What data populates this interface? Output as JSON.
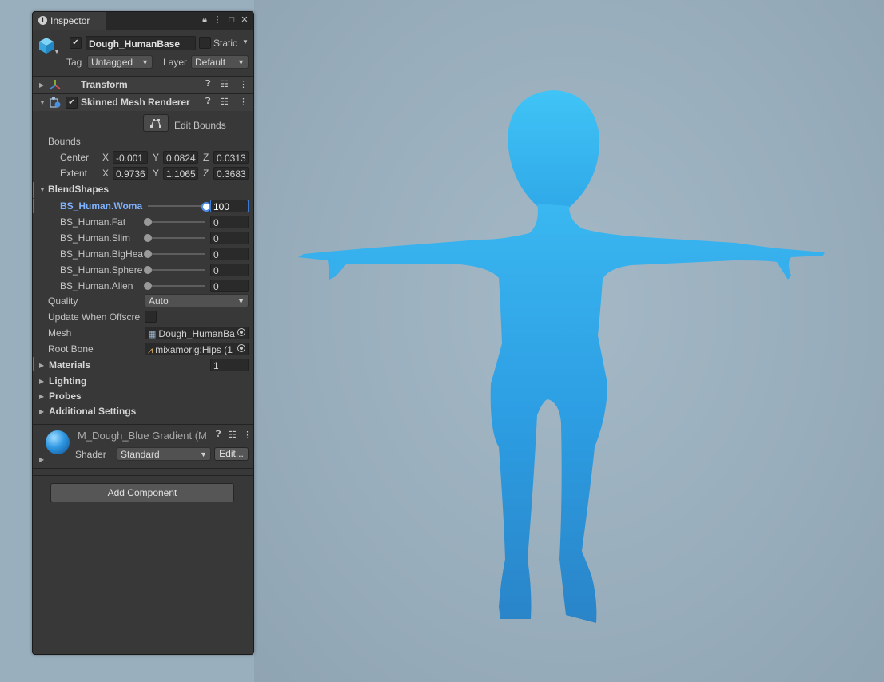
{
  "inspector": {
    "tab_label": "Inspector",
    "object": {
      "name": "Dough_HumanBase",
      "active": true,
      "static_label": "Static",
      "tag_label": "Tag",
      "tag_value": "Untagged",
      "layer_label": "Layer",
      "layer_value": "Default"
    },
    "transform": {
      "label": "Transform"
    },
    "skinned_mesh_renderer": {
      "label": "Skinned Mesh Renderer",
      "enabled": true,
      "edit_bounds_label": "Edit Bounds",
      "bounds_label": "Bounds",
      "center": {
        "label": "Center",
        "x": "-0.001",
        "y": "0.0824",
        "z": "0.0313"
      },
      "extent": {
        "label": "Extent",
        "x": "0.9736",
        "y": "1.1065",
        "z": "0.3683"
      },
      "axis_x": "X",
      "axis_y": "Y",
      "axis_z": "Z",
      "blendshapes_label": "BlendShapes",
      "blendshapes": [
        {
          "name": "BS_Human.Woma",
          "value": "100",
          "level": 1.0
        },
        {
          "name": "BS_Human.Fat",
          "value": "0",
          "level": 0
        },
        {
          "name": "BS_Human.Slim",
          "value": "0",
          "level": 0
        },
        {
          "name": "BS_Human.BigHea",
          "value": "0",
          "level": 0
        },
        {
          "name": "BS_Human.Sphere",
          "value": "0",
          "level": 0
        },
        {
          "name": "BS_Human.Alien",
          "value": "0",
          "level": 0
        }
      ],
      "quality_label": "Quality",
      "quality_value": "Auto",
      "update_offscreen_label": "Update When Offscre",
      "mesh_label": "Mesh",
      "mesh_value": "Dough_HumanBa",
      "root_bone_label": "Root Bone",
      "root_bone_value": "mixamorig:Hips (1",
      "materials_label": "Materials",
      "materials_count": "1",
      "lighting_label": "Lighting",
      "probes_label": "Probes",
      "additional_settings_label": "Additional Settings"
    },
    "material": {
      "name": "M_Dough_Blue Gradient (M",
      "shader_label": "Shader",
      "shader_value": "Standard",
      "edit_label": "Edit..."
    },
    "add_component_label": "Add Component"
  },
  "colors": {
    "viewport_bg": "#9aafbd",
    "character": "#2a9be0",
    "accent": "#3a7bd5"
  }
}
